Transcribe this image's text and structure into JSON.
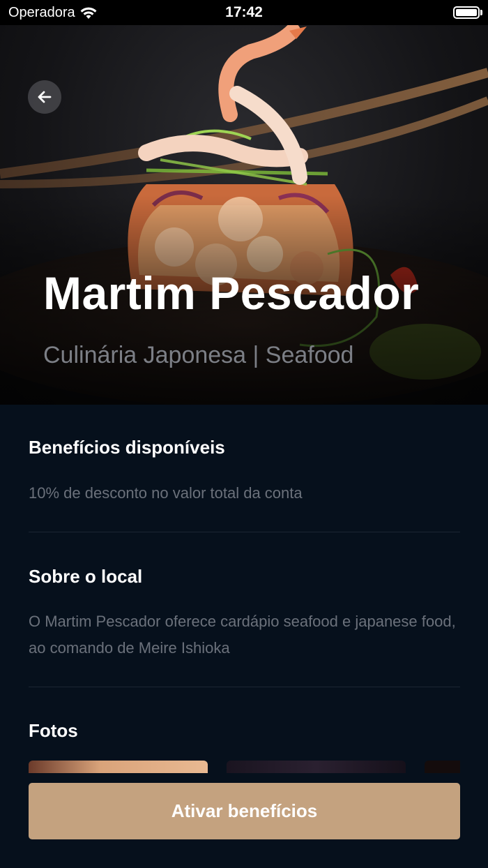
{
  "status_bar": {
    "carrier": "Operadora",
    "time": "17:42"
  },
  "hero": {
    "title": "Martim Pescador",
    "subtitle": "Culinária Japonesa | Seafood"
  },
  "sections": {
    "benefits": {
      "title": "Benefícios disponíveis",
      "text": "10% de desconto no valor total da conta"
    },
    "about": {
      "title": "Sobre o local",
      "text": "O Martim Pescador oferece cardápio seafood e japanese food, ao comando de Meire Ishioka"
    },
    "photos": {
      "title": "Fotos"
    }
  },
  "cta": {
    "label": "Ativar benefícios"
  },
  "colors": {
    "background": "#06101c",
    "accent": "#c4a27f",
    "muted_text": "#6b717b"
  },
  "icons": [
    "wifi-icon",
    "battery-icon",
    "back-arrow-icon"
  ]
}
